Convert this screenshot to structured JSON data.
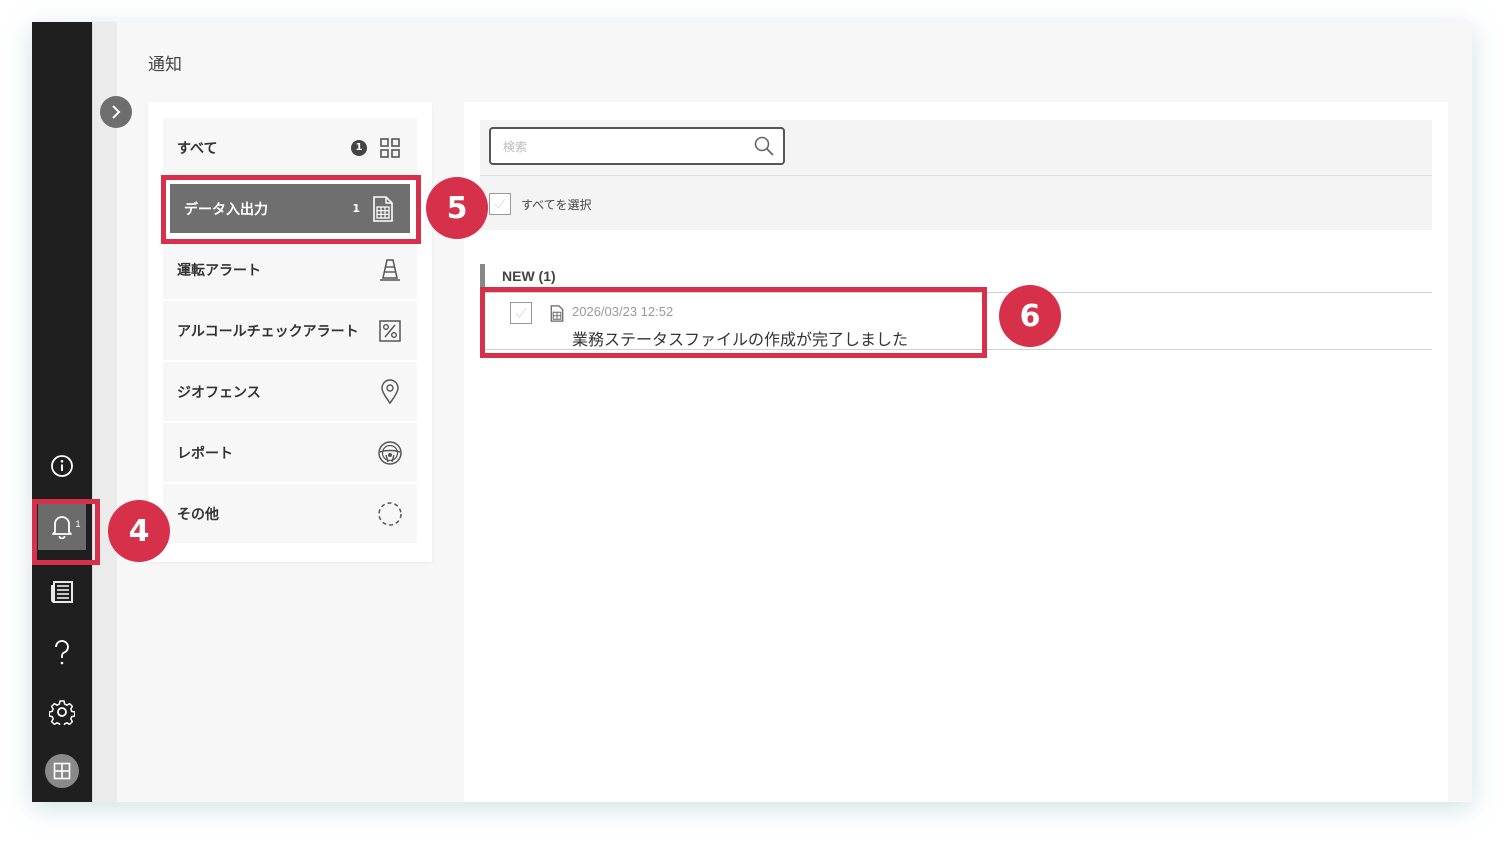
{
  "page": {
    "title": "通知"
  },
  "colors": {
    "rail": "#1f1f1f",
    "active": "#6f6f6f",
    "highlight": "#d6304a"
  },
  "sidebar": {
    "items": [
      {
        "icon": "info-icon"
      },
      {
        "icon": "bell-icon",
        "badge": "1"
      },
      {
        "icon": "newspaper-icon"
      },
      {
        "icon": "help-icon"
      },
      {
        "icon": "gear-icon"
      },
      {
        "icon": "avatar-icon"
      }
    ]
  },
  "categories": {
    "all": {
      "label": "すべて",
      "count": "1",
      "icon": "grid-icon"
    },
    "data_io": {
      "label": "データ入出力",
      "count": "1",
      "icon": "spreadsheet-icon"
    },
    "driving_alert": {
      "label": "運転アラート",
      "icon": "traffic-cone-icon"
    },
    "alcohol_alert": {
      "label": "アルコールチェックアラート",
      "icon": "percent-icon"
    },
    "geofence": {
      "label": "ジオフェンス",
      "icon": "location-pin-icon"
    },
    "report": {
      "label": "レポート",
      "icon": "steering-wheel-icon"
    },
    "other": {
      "label": "その他",
      "icon": "dashed-circle-icon"
    }
  },
  "search": {
    "placeholder": "検索",
    "value": ""
  },
  "select_all": {
    "label": "すべてを選択"
  },
  "section": {
    "title": "NEW (1)"
  },
  "notifications": [
    {
      "date": "2026/03/23 12:52",
      "text": "業務ステータスファイルの作成が完了しました",
      "icon": "spreadsheet-icon"
    }
  ],
  "markers": {
    "m4": "4",
    "m5": "5",
    "m6": "6"
  }
}
